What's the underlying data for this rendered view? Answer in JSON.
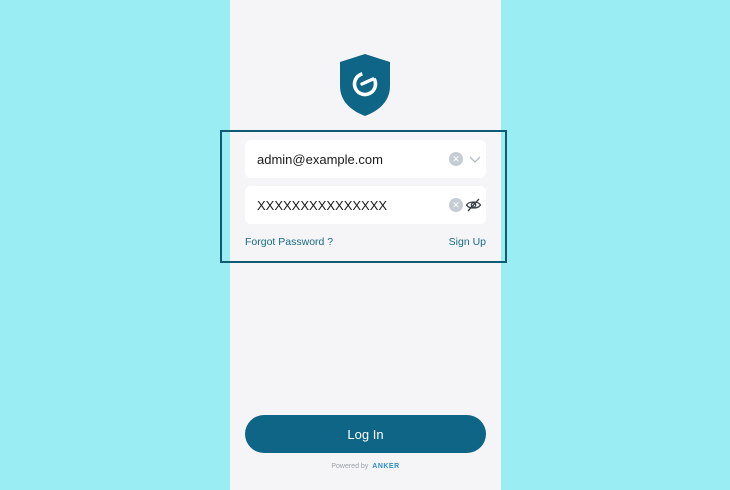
{
  "app": {
    "logo_icon": "shield-e-logo-icon",
    "colors": {
      "background": "#9bedf4",
      "panel": "#f5f5f8",
      "accent": "#0e6585",
      "highlight": "#0e5b73",
      "link": "#1a6a85"
    }
  },
  "login_form": {
    "email": {
      "value": "admin@example.com",
      "clear_icon": "clear-icon",
      "dropdown_icon": "chevron-down-icon"
    },
    "password": {
      "value": "XXXXXXXXXXXXXXX",
      "clear_icon": "clear-icon",
      "visibility_icon": "eye-slash-icon"
    },
    "forgot_password_label": "Forgot Password ?",
    "sign_up_label": "Sign Up",
    "login_button_label": "Log In"
  },
  "footer": {
    "powered_by_label": "Powered by",
    "brand": "ANKER"
  }
}
